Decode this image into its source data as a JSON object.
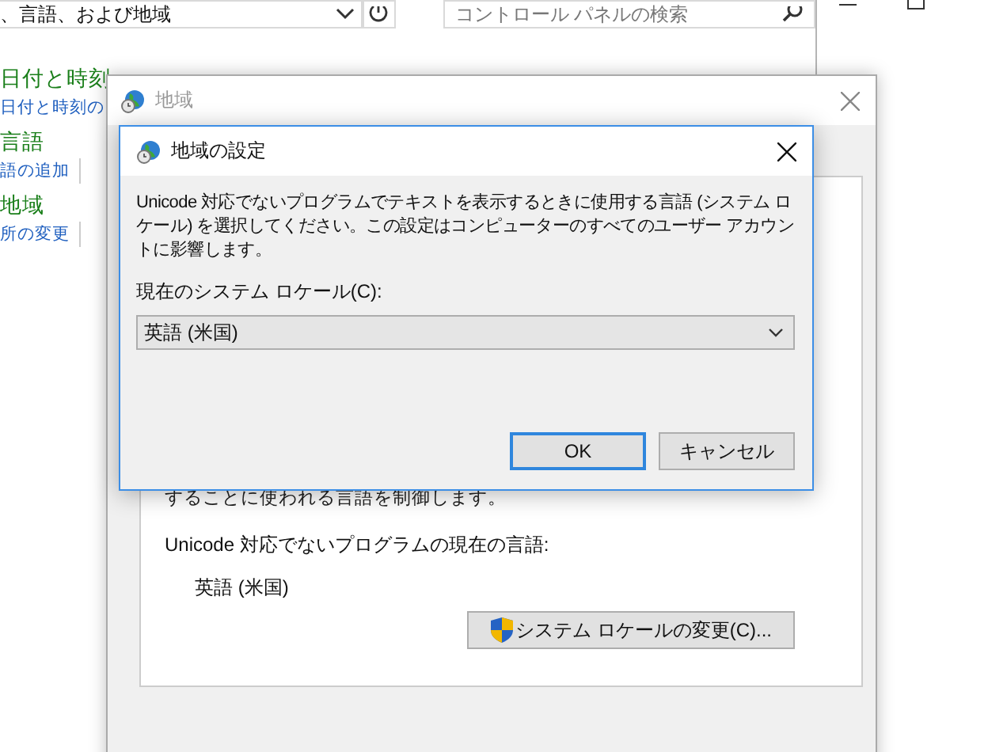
{
  "control_panel": {
    "address": "、言語、および地域",
    "search": {
      "placeholder": "コントロール パネルの検索"
    },
    "sections": [
      {
        "heading": "日付と時刻",
        "links": [
          "日付と時刻の"
        ]
      },
      {
        "heading": "言語",
        "links": [
          "語の追加"
        ]
      },
      {
        "heading": "地域",
        "links": [
          "所の変更"
        ]
      }
    ]
  },
  "region_dialog": {
    "title": "地域",
    "active": false,
    "partial_text": "することに使われる言語を制御します。",
    "current_language_label": "Unicode 対応でないプログラムの現在の言語:",
    "current_language": "英語 (米国)",
    "change_button": "システム ロケールの変更(C)..."
  },
  "locale_dialog": {
    "title": "地域の設定",
    "active": true,
    "description": "Unicode 対応でないプログラムでテキストを表示するときに使用する言語 (システム ロケール) を選択してください。この設定はコンピューターのすべてのユーザー アカウントに影響します。",
    "locale_label": "現在のシステム ロケール(C):",
    "locale_value": "英語 (米国)",
    "buttons": [
      {
        "label": "OK",
        "default": true
      },
      {
        "label": "キャンセル",
        "default": false
      }
    ]
  }
}
